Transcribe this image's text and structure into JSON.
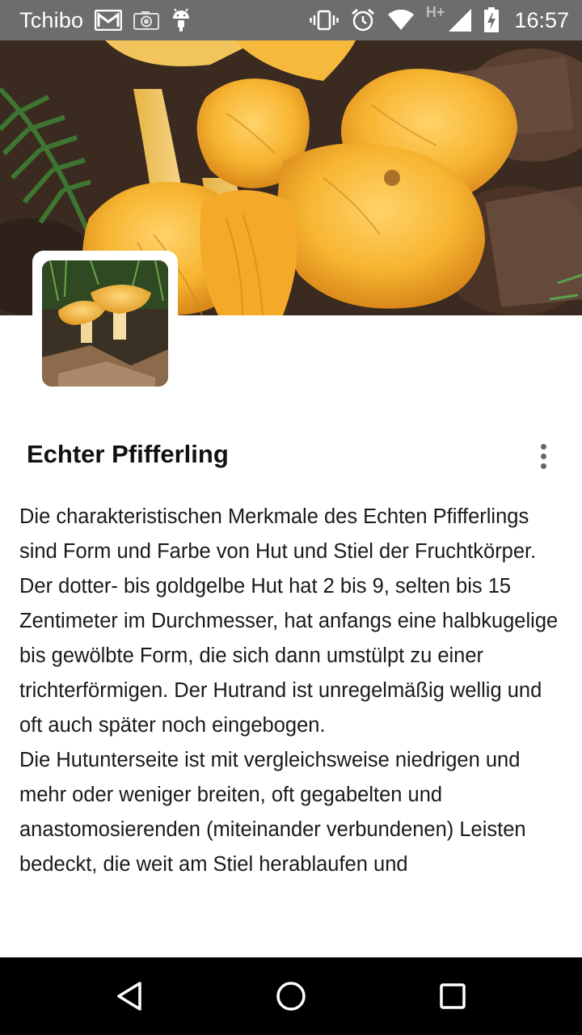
{
  "status_bar": {
    "carrier": "Tchibo",
    "network_type": "H+",
    "time": "16:57",
    "icons_left": [
      "gmail-icon",
      "camera-icon",
      "android-icon"
    ],
    "icons_right": [
      "vibrate-icon",
      "alarm-icon",
      "wifi-icon",
      "signal-icon",
      "battery-charging-icon"
    ]
  },
  "header": {
    "image": "chanterelle-mushrooms-photo"
  },
  "thumbnail": {
    "image": "chanterelle-thumbnail-photo"
  },
  "article": {
    "title": "Echter Pfifferling",
    "paragraphs": [
      "Die charakteristischen Merkmale des Echten Pfifferlings sind Form und Farbe von Hut und Stiel der Fruchtkörper.",
      "Der dotter- bis goldgelbe Hut hat 2 bis 9, selten bis 15 Zentimeter im Durchmesser, hat anfangs eine halbkugelige bis gewölbte Form, die sich dann umstülpt zu einer trichterförmigen. Der Hutrand ist unregelmäßig wellig und oft auch später noch eingebogen.",
      "Die Hutunterseite ist mit vergleichsweise niedrigen und mehr oder weniger breiten, oft gegabelten und anastomosierenden (miteinander verbundenen) Leisten bedeckt, die weit am Stiel herablaufen und"
    ]
  },
  "nav_bar": {
    "buttons": [
      "back-icon",
      "home-icon",
      "recents-icon"
    ]
  },
  "colors": {
    "status_bar": "#6d6d6d",
    "nav_bar": "#000000",
    "mushroom": "#f5b02e",
    "text": "#1a1a1a"
  }
}
